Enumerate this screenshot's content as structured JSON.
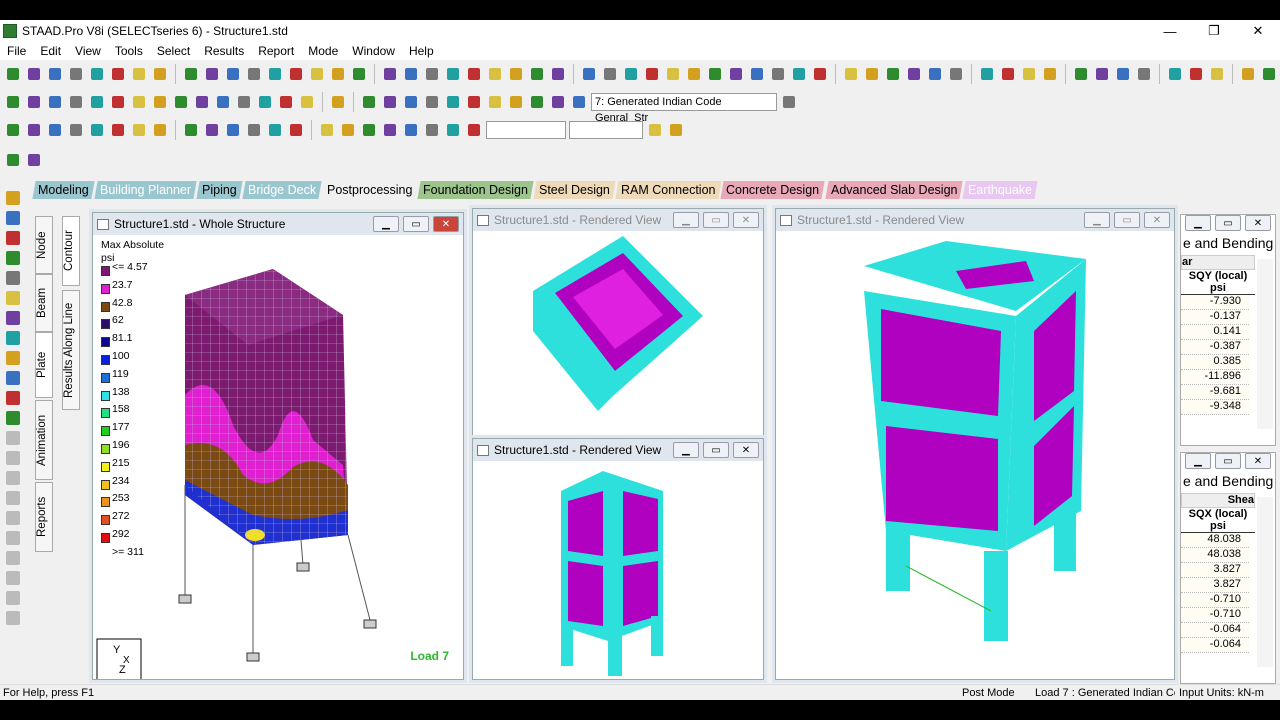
{
  "app": {
    "title": "STAAD.Pro V8i (SELECTseries 6) - Structure1.std",
    "controls": [
      "—",
      "❐",
      "✕"
    ]
  },
  "menu": [
    "File",
    "Edit",
    "View",
    "Tools",
    "Select",
    "Results",
    "Report",
    "Mode",
    "Window",
    "Help"
  ],
  "toolbar": {
    "load_case": "7: Generated Indian Code Genral_Str"
  },
  "workflow_tabs": [
    {
      "label": "Modeling",
      "bg": "#9ac6cf",
      "fg": "#000"
    },
    {
      "label": "Building Planner",
      "bg": "#9ac6cf",
      "fg": "#fff"
    },
    {
      "label": "Piping",
      "bg": "#9ac6cf",
      "fg": "#000"
    },
    {
      "label": "Bridge Deck",
      "bg": "#9ac6cf",
      "fg": "#fff"
    },
    {
      "label": "Postprocessing",
      "bg": "#f0f0f0",
      "fg": "#000"
    },
    {
      "label": "Foundation Design",
      "bg": "#9cc48c",
      "fg": "#000"
    },
    {
      "label": "Steel Design",
      "bg": "#eed9b8",
      "fg": "#000"
    },
    {
      "label": "RAM Connection",
      "bg": "#eed9b8",
      "fg": "#000"
    },
    {
      "label": "Concrete Design",
      "bg": "#e8a8b8",
      "fg": "#000"
    },
    {
      "label": "Advanced Slab Design",
      "bg": "#e8a8b8",
      "fg": "#000"
    },
    {
      "label": "Earthquake",
      "bg": "#e8c8f0",
      "fg": "#fff"
    }
  ],
  "side_tabs": {
    "outer": [
      "Node",
      "Beam",
      "Plate",
      "Animation",
      "Reports"
    ],
    "inner": [
      "Contour",
      "Results Along Line"
    ]
  },
  "windows": {
    "main": {
      "title": "Structure1.std - Whole Structure",
      "load_label": "Load 7"
    },
    "rendered_title": "Structure1.std - Rendered View"
  },
  "legend": {
    "title": "Max Absolute",
    "unit": "psi",
    "entries": [
      {
        "label": "<= 4.57",
        "color": "#7b1a6e"
      },
      {
        "label": "23.7",
        "color": "#e020d0"
      },
      {
        "label": "42.8",
        "color": "#7a4a12"
      },
      {
        "label": "62",
        "color": "#300a6a"
      },
      {
        "label": "81.1",
        "color": "#0a0a90"
      },
      {
        "label": "100",
        "color": "#0a20e0"
      },
      {
        "label": "119",
        "color": "#2070d8"
      },
      {
        "label": "138",
        "color": "#30e0e8"
      },
      {
        "label": "158",
        "color": "#20e080"
      },
      {
        "label": "177",
        "color": "#20d020"
      },
      {
        "label": "196",
        "color": "#90e020"
      },
      {
        "label": "215",
        "color": "#f0f020"
      },
      {
        "label": "234",
        "color": "#f0c020"
      },
      {
        "label": "253",
        "color": "#f09020"
      },
      {
        "label": "272",
        "color": "#e05020"
      },
      {
        "label": "292",
        "color": "#e01010"
      },
      {
        "label": ">= 311",
        "color": ""
      }
    ]
  },
  "tables": [
    {
      "title": "e and Bending",
      "group": "ar",
      "column": "SQY (local)",
      "unit": "psi",
      "values": [
        "-7.930",
        "-0.137",
        "0.141",
        "-0.387",
        "0.385",
        "-11.896",
        "-9.681",
        "-9.348"
      ]
    },
    {
      "title": "e and Bending",
      "group": "Shea",
      "column": "SQX (local)",
      "unit": "psi",
      "values": [
        "48.038",
        "48.038",
        "3.827",
        "3.827",
        "-0.710",
        "-0.710",
        "-0.064",
        "-0.064"
      ]
    }
  ],
  "status": {
    "help": "For Help, press F1",
    "mode": "Post Mode",
    "load": "Load 7 : Generated Indian Cc",
    "units": "Input Units:  kN-m"
  },
  "colors": {
    "cyan": "#2ee0dc",
    "magenta": "#b000c0",
    "accent_green": "#2eb82e"
  }
}
